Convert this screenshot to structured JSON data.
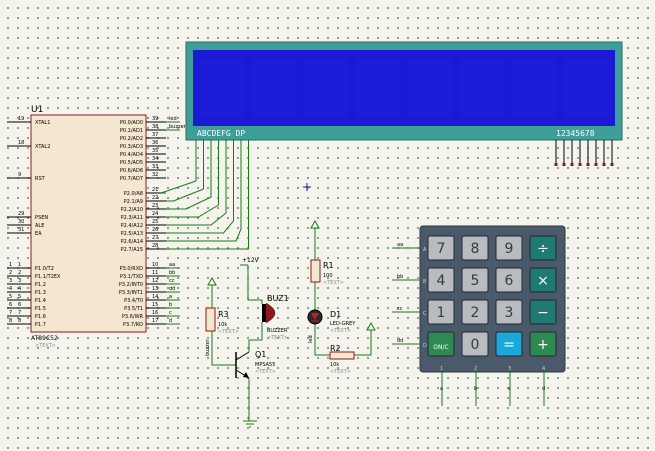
{
  "mcu": {
    "ref": "U1",
    "part": "AT89C52",
    "text": "<TEXT>",
    "left_pins": [
      {
        "num": "19",
        "name": "XTAL1"
      },
      {
        "num": "18",
        "name": "XTAL2"
      },
      {
        "num": "9",
        "name": "RST"
      },
      {
        "num": "29",
        "name": "PSEN"
      },
      {
        "num": "30",
        "name": "ALE"
      },
      {
        "num": "31",
        "name": "EA"
      },
      {
        "num": "1",
        "name": "P1.0/T2"
      },
      {
        "num": "2",
        "name": "P1.1/T2EX"
      },
      {
        "num": "3",
        "name": "P1.2"
      },
      {
        "num": "4",
        "name": "P1.3"
      },
      {
        "num": "5",
        "name": "P1.4"
      },
      {
        "num": "6",
        "name": "P1.5"
      },
      {
        "num": "7",
        "name": "P1.6"
      },
      {
        "num": "8",
        "name": "P1.7"
      }
    ],
    "right_pins": [
      {
        "num": "39",
        "name": "P0.0/AD0",
        "net": "led"
      },
      {
        "num": "38",
        "name": "P0.1/AD1",
        "net": "buzzer"
      },
      {
        "num": "37",
        "name": "P0.2/AD2",
        "net": ""
      },
      {
        "num": "36",
        "name": "P0.3/AD3",
        "net": ""
      },
      {
        "num": "35",
        "name": "P0.4/AD4",
        "net": ""
      },
      {
        "num": "34",
        "name": "P0.5/AD5",
        "net": ""
      },
      {
        "num": "33",
        "name": "P0.6/AD6",
        "net": ""
      },
      {
        "num": "32",
        "name": "P0.7/AD7",
        "net": ""
      },
      {
        "num": "21",
        "name": "P2.0/A8",
        "net": ""
      },
      {
        "num": "22",
        "name": "P2.1/A9",
        "net": ""
      },
      {
        "num": "23",
        "name": "P2.2/A10",
        "net": ""
      },
      {
        "num": "24",
        "name": "P2.3/A11",
        "net": ""
      },
      {
        "num": "25",
        "name": "P2.4/A12",
        "net": ""
      },
      {
        "num": "26",
        "name": "P2.5/A13",
        "net": ""
      },
      {
        "num": "27",
        "name": "P2.6/A14",
        "net": ""
      },
      {
        "num": "28",
        "name": "P2.7/A15",
        "net": ""
      },
      {
        "num": "10",
        "name": "P3.0/RXD",
        "net": "aa"
      },
      {
        "num": "11",
        "name": "P3.1/TXD",
        "net": "bb"
      },
      {
        "num": "12",
        "name": "P3.2/INT0",
        "net": "cc"
      },
      {
        "num": "13",
        "name": "P3.3/INT1",
        "net": "dd"
      },
      {
        "num": "14",
        "name": "P3.4/T0",
        "net": "a"
      },
      {
        "num": "15",
        "name": "P3.5/T1",
        "net": "b"
      },
      {
        "num": "16",
        "name": "P3.6/WR",
        "net": "c"
      },
      {
        "num": "17",
        "name": "P3.7/RD",
        "net": "d"
      }
    ]
  },
  "display": {
    "seg_label": "ABCDEFG DP",
    "dig_label": "12345678"
  },
  "components": {
    "r1": {
      "ref": "R1",
      "value": "100",
      "text": "<TEXT>"
    },
    "r2": {
      "ref": "R2",
      "value": "10k",
      "text": "<TEXT>"
    },
    "r3": {
      "ref": "R3",
      "value": "10k",
      "text": "<TEXT>"
    },
    "d1": {
      "ref": "D1",
      "value": "LED-GREY",
      "text": "<TEXT>"
    },
    "buz": {
      "ref": "BUZ1",
      "value": "BUZZER",
      "text": "<TEXT>"
    },
    "q1": {
      "ref": "Q1",
      "value": "MPSA55",
      "text": "<TEXT>"
    },
    "vcc": "+12V"
  },
  "nets": {
    "buzzer_net": "buzzer",
    "led_net": "led",
    "keypad_rows": [
      "aa",
      "bb",
      "cc",
      "dd"
    ],
    "keypad_cols": [
      "a",
      "b",
      "c",
      "d"
    ]
  },
  "keypad": {
    "row_letters": [
      "A",
      "B",
      "C",
      "D"
    ],
    "col_numbers": [
      "1",
      "2",
      "3",
      "4"
    ],
    "keys": [
      [
        "7",
        "8",
        "9",
        "÷"
      ],
      [
        "4",
        "5",
        "6",
        "×"
      ],
      [
        "1",
        "2",
        "3",
        "−"
      ],
      [
        "ON/C",
        "0",
        "=",
        "+"
      ]
    ]
  },
  "colors": {
    "wire": "#1a7a1a",
    "chip_fill": "#f5e6d0",
    "chip_border": "#8b1a1a",
    "lcd_frame": "#3e9e98",
    "lcd_screen": "#1a1ad6",
    "text_red": "#8b1a1a",
    "keypad_body": "#4a5a6a",
    "key_gray": "#b8bcc0",
    "key_teal": "#1e7a72",
    "key_blue": "#1aa8d8",
    "key_green": "#2e8a50"
  }
}
